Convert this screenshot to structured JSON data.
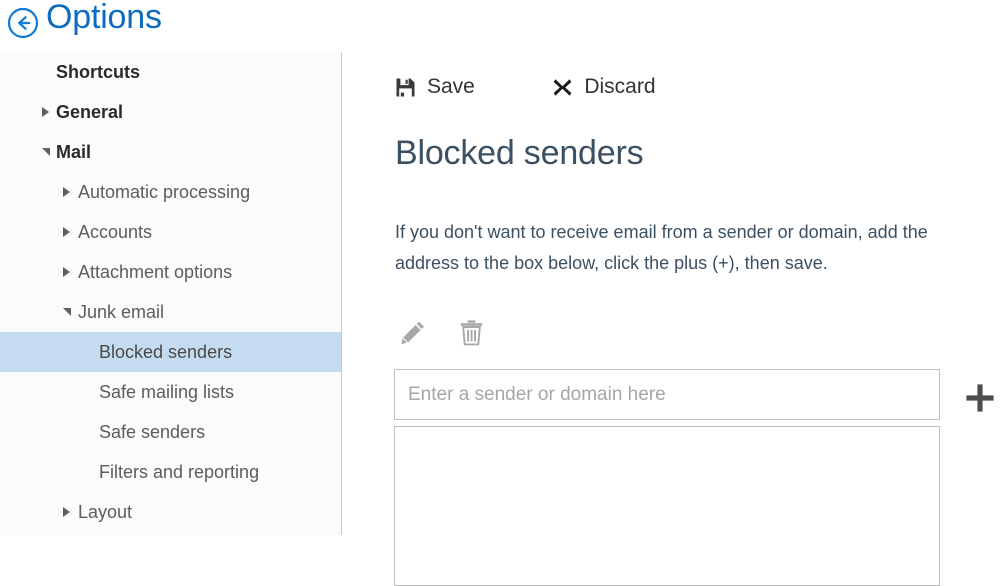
{
  "header": {
    "back_icon": "back-arrow-circle-icon",
    "title": "Options",
    "accent_color": "#0f6cbd"
  },
  "sidebar": {
    "items": [
      {
        "label": "Shortcuts",
        "level": 0,
        "bold": true,
        "marker": "none",
        "selected": false
      },
      {
        "label": "General",
        "level": 0,
        "bold": true,
        "marker": "collapsed",
        "selected": false
      },
      {
        "label": "Mail",
        "level": 0,
        "bold": true,
        "marker": "expanded",
        "selected": false
      },
      {
        "label": "Automatic processing",
        "level": 1,
        "bold": false,
        "marker": "collapsed",
        "selected": false
      },
      {
        "label": "Accounts",
        "level": 1,
        "bold": false,
        "marker": "collapsed",
        "selected": false
      },
      {
        "label": "Attachment options",
        "level": 1,
        "bold": false,
        "marker": "collapsed",
        "selected": false
      },
      {
        "label": "Junk email",
        "level": 1,
        "bold": false,
        "marker": "expanded",
        "selected": false
      },
      {
        "label": "Blocked senders",
        "level": 2,
        "bold": false,
        "marker": "none",
        "selected": true
      },
      {
        "label": "Safe mailing lists",
        "level": 2,
        "bold": false,
        "marker": "none",
        "selected": false
      },
      {
        "label": "Safe senders",
        "level": 2,
        "bold": false,
        "marker": "none",
        "selected": false
      },
      {
        "label": "Filters and reporting",
        "level": 2,
        "bold": false,
        "marker": "none",
        "selected": false
      },
      {
        "label": "Layout",
        "level": 1,
        "bold": false,
        "marker": "collapsed",
        "selected": false
      }
    ],
    "selected_highlight_color": "#c5dcf0"
  },
  "main": {
    "command_bar": {
      "save_label": "Save",
      "save_icon": "save-floppy-icon",
      "discard_label": "Discard",
      "discard_icon": "close-x-icon"
    },
    "page_title": "Blocked senders",
    "description": "If you don't want to receive email from a sender or domain, add the address to the box below, click the plus (+), then save.",
    "tools": {
      "edit_icon": "pencil-edit-icon",
      "delete_icon": "trash-delete-icon",
      "disabled_color": "#a8a8a8"
    },
    "sender_input": {
      "placeholder": "Enter a sender or domain here",
      "value": ""
    },
    "add_button": {
      "icon": "plus-add-icon"
    },
    "sender_list": {
      "items": []
    }
  }
}
